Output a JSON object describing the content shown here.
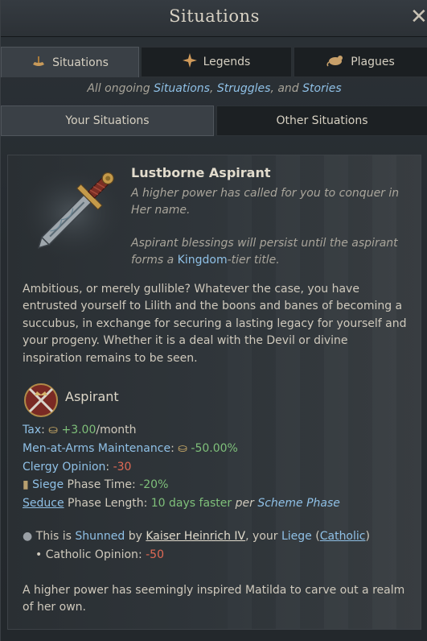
{
  "window": {
    "title": "Situations",
    "close_glyph": "✕"
  },
  "tabs": [
    {
      "label": "Situations",
      "icon": "situations-icon",
      "active": true
    },
    {
      "label": "Legends",
      "icon": "legends-icon",
      "active": false
    },
    {
      "label": "Plagues",
      "icon": "plagues-icon",
      "active": false
    }
  ],
  "subtitle": {
    "prefix": "All ongoing ",
    "link1": "Situations",
    "sep1": ", ",
    "link2": "Struggles",
    "sep2": ", and ",
    "link3": "Stories"
  },
  "subtabs": [
    {
      "label": "Your Situations",
      "active": true
    },
    {
      "label": "Other Situations",
      "active": false
    }
  ],
  "situation": {
    "title": "Lustborne Aspirant",
    "desc1": "A higher power has called for you to conquer in Her name.",
    "desc2_a": "Aspirant blessings will persist until the aspirant forms a ",
    "desc2_link": "Kingdom",
    "desc2_b": "-tier title.",
    "body": "Ambitious, or merely gullible? Whatever the case, you have entrusted yourself to Lilith and the boons and banes of becoming a succubus, in exchange for securing a lasting legacy for yourself and your progeny. Whether it is a deal with the Devil or divine inspiration remains to be seen.",
    "phase_title": "Aspirant",
    "modifiers": {
      "tax_label": "Tax",
      "tax_value": "+3.00",
      "tax_unit": "/month",
      "maa_label": "Men-at-Arms Maintenance",
      "maa_value": "-50.00%",
      "clergy_label": "Clergy Opinion",
      "clergy_value": "-30",
      "siege_label": "Siege",
      "siege_rest": " Phase Time",
      "siege_value": "-20%",
      "seduce_label": "Seduce",
      "seduce_rest": " Phase Length",
      "seduce_value": "10 days faster",
      "seduce_per": " per ",
      "seduce_link": "Scheme Phase"
    },
    "shunned": {
      "prefix": "This is ",
      "shunned": "Shunned",
      "by": " by ",
      "person": "Kaiser Heinrich IV",
      "comma": ", your ",
      "liege": "Liege",
      "paren_open": " (",
      "faith": "Catholic",
      "paren_close": ")",
      "bullet_label": "Catholic Opinion",
      "bullet_value": "-50"
    },
    "footer": "A higher power has seemingly inspired Matilda to carve out a realm of her own."
  },
  "colors": {
    "link": "#8fc0e6",
    "positive": "#7fc07a",
    "negative": "#e06a55",
    "gold": "#d5b26a"
  }
}
